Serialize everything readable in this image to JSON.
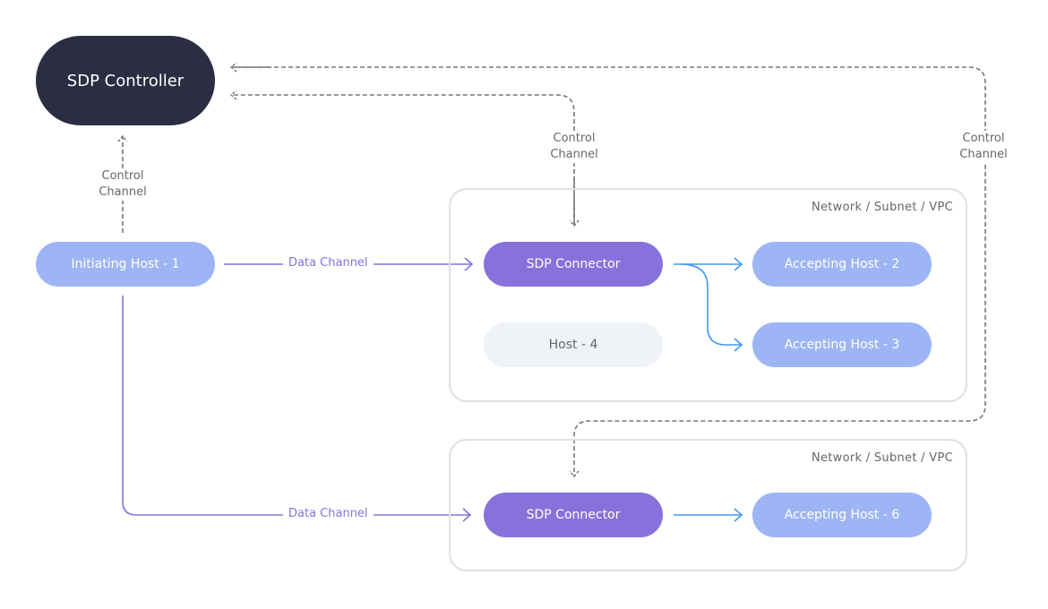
{
  "controller": {
    "label": "SDP Controller"
  },
  "initiating_host": {
    "label": "Initiating Host - 1"
  },
  "networks": [
    {
      "label": "Network / Subnet / VPC",
      "connector": "SDP Connector",
      "hosts": [
        "Accepting Host - 2",
        "Accepting Host - 3",
        "Host - 4"
      ]
    },
    {
      "label": "Network / Subnet / VPC",
      "connector": "SDP Connector",
      "hosts": [
        "Accepting Host - 6"
      ]
    }
  ],
  "channels": {
    "control_line1": "Control",
    "control_line2": "Channel",
    "data": "Data Channel"
  },
  "colors": {
    "controller": "#2b2d42",
    "host": "#9db5f4",
    "connector": "#8772db",
    "inactive_host": "#eff2f7",
    "data_channel": "#8772db",
    "connector_to_host": "#3f9af0",
    "control_channel": "#777777"
  }
}
